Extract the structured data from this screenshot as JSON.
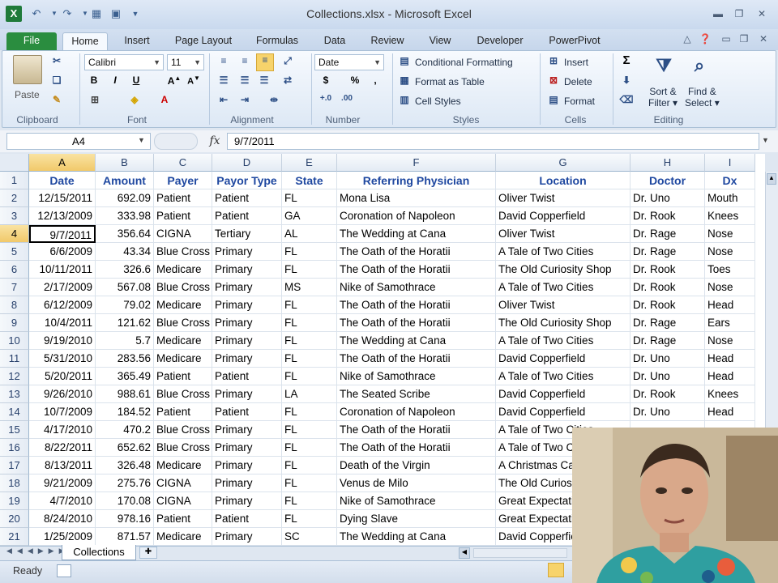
{
  "window": {
    "title": "Collections.xlsx - Microsoft Excel"
  },
  "ribbon_tabs": [
    "File",
    "Home",
    "Insert",
    "Page Layout",
    "Formulas",
    "Data",
    "Review",
    "View",
    "Developer",
    "PowerPivot"
  ],
  "clipboard": {
    "paste": "Paste",
    "label": "Clipboard"
  },
  "font": {
    "name": "Calibri",
    "size": "11",
    "label": "Font"
  },
  "alignment": {
    "label": "Alignment"
  },
  "number": {
    "format": "Date",
    "label": "Number"
  },
  "styles": {
    "conditional": "Conditional Formatting",
    "format_table": "Format as Table",
    "cell_styles": "Cell Styles",
    "label": "Styles"
  },
  "cells": {
    "insert": "Insert",
    "delete": "Delete",
    "format": "Format",
    "label": "Cells"
  },
  "editing": {
    "sort1": "Sort &",
    "sort2": "Filter",
    "find1": "Find &",
    "find2": "Select",
    "label": "Editing"
  },
  "formula_bar": {
    "name_box": "A4",
    "fx": "fx",
    "formula": "9/7/2011"
  },
  "columns": [
    "A",
    "B",
    "C",
    "D",
    "E",
    "F",
    "G",
    "H",
    "I"
  ],
  "headers": [
    "Date",
    "Amount",
    "Payer",
    "Payor Type",
    "State",
    "Referring Physician",
    "Location",
    "Doctor",
    "Dx"
  ],
  "rows": [
    [
      "12/15/2011",
      "692.09",
      "Patient",
      "Patient",
      "FL",
      "Mona Lisa",
      "Oliver Twist",
      "Dr. Uno",
      "Mouth"
    ],
    [
      "12/13/2009",
      "333.98",
      "Patient",
      "Patient",
      "GA",
      "Coronation of Napoleon",
      "David Copperfield",
      "Dr. Rook",
      "Knees"
    ],
    [
      "9/7/2011",
      "356.64",
      "CIGNA",
      "Tertiary",
      "AL",
      "The Wedding at Cana",
      "Oliver Twist",
      "Dr. Rage",
      "Nose"
    ],
    [
      "6/6/2009",
      "43.34",
      "Blue Cross",
      "Primary",
      "FL",
      "The Oath of the Horatii",
      "A Tale of Two Cities",
      "Dr. Rage",
      "Nose"
    ],
    [
      "10/11/2011",
      "326.6",
      "Medicare",
      "Primary",
      "FL",
      "The Oath of the Horatii",
      "The Old Curiosity Shop",
      "Dr. Rook",
      "Toes"
    ],
    [
      "2/17/2009",
      "567.08",
      "Blue Cross",
      "Primary",
      "MS",
      "Nike of Samothrace",
      "A Tale of Two Cities",
      "Dr. Rook",
      "Nose"
    ],
    [
      "6/12/2009",
      "79.02",
      "Medicare",
      "Primary",
      "FL",
      "The Oath of the Horatii",
      "Oliver Twist",
      "Dr. Rook",
      "Head"
    ],
    [
      "10/4/2011",
      "121.62",
      "Blue Cross",
      "Primary",
      "FL",
      "The Oath of the Horatii",
      "The Old Curiosity Shop",
      "Dr. Rage",
      "Ears"
    ],
    [
      "9/19/2010",
      "5.7",
      "Medicare",
      "Primary",
      "FL",
      "The Wedding at Cana",
      "A Tale of Two Cities",
      "Dr. Rage",
      "Nose"
    ],
    [
      "5/31/2010",
      "283.56",
      "Medicare",
      "Primary",
      "FL",
      "The Oath of the Horatii",
      "David Copperfield",
      "Dr. Uno",
      "Head"
    ],
    [
      "5/20/2011",
      "365.49",
      "Patient",
      "Patient",
      "FL",
      "Nike of Samothrace",
      "A Tale of Two Cities",
      "Dr. Uno",
      "Head"
    ],
    [
      "9/26/2010",
      "988.61",
      "Blue Cross",
      "Primary",
      "LA",
      "The Seated Scribe",
      "David Copperfield",
      "Dr. Rook",
      "Knees"
    ],
    [
      "10/7/2009",
      "184.52",
      "Patient",
      "Patient",
      "FL",
      "Coronation of Napoleon",
      "David Copperfield",
      "Dr. Uno",
      "Head"
    ],
    [
      "4/17/2010",
      "470.2",
      "Blue Cross",
      "Primary",
      "FL",
      "The Oath of the Horatii",
      "A Tale of Two Cities",
      "",
      ""
    ],
    [
      "8/22/2011",
      "652.62",
      "Blue Cross",
      "Primary",
      "FL",
      "The Oath of the Horatii",
      "A Tale of Two Cities",
      "",
      ""
    ],
    [
      "8/13/2011",
      "326.48",
      "Medicare",
      "Primary",
      "FL",
      "Death of the Virgin",
      "A Christmas Carol",
      "",
      ""
    ],
    [
      "9/21/2009",
      "275.76",
      "CIGNA",
      "Primary",
      "FL",
      "Venus de Milo",
      "The Old Curiosity Shop",
      "",
      ""
    ],
    [
      "4/7/2010",
      "170.08",
      "CIGNA",
      "Primary",
      "FL",
      "Nike of Samothrace",
      "Great Expectations",
      "",
      ""
    ],
    [
      "8/24/2010",
      "978.16",
      "Patient",
      "Patient",
      "FL",
      "Dying Slave",
      "Great Expectations",
      "",
      ""
    ],
    [
      "1/25/2009",
      "871.57",
      "Medicare",
      "Primary",
      "SC",
      "The Wedding at Cana",
      "David Copperfield",
      "",
      ""
    ]
  ],
  "sheet_tab": "Collections",
  "status": "Ready"
}
